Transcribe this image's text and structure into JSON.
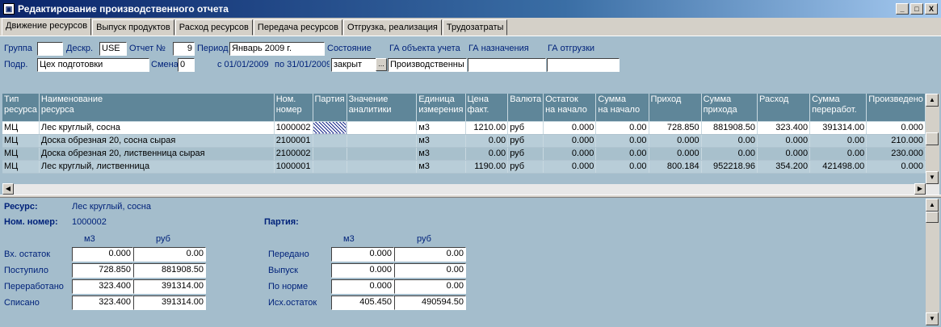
{
  "window": {
    "title": "Редактирование производственного отчета",
    "icon": "app-icon",
    "min": "_",
    "max": "□",
    "close": "X"
  },
  "tabs": [
    "Движение ресурсов",
    "Выпуск продуктов",
    "Расход ресурсов",
    "Передача ресурсов",
    "Отгрузка, реализация",
    "Трудозатраты"
  ],
  "filters": {
    "group_label": "Группа",
    "group_value": "",
    "descr_label": "Дескр.",
    "descr_value": "USE",
    "report_label": "Отчет №",
    "report_value": "9",
    "period_label": "Период",
    "period_value": "Январь 2009 г.",
    "state_label": "Состояние",
    "ga_object_label": "ГА объекта учета",
    "ga_dest_label": "ГА назначения",
    "ga_ship_label": "ГА отгрузки",
    "dept_label": "Подр.",
    "dept_value": "Цех подготовки",
    "shift_label": "Смена",
    "shift_value": "0",
    "date_from": "с 01/01/2009",
    "date_to": "по 31/01/2009",
    "state_value": "закрыт",
    "state_btn": "...",
    "ga_object_value": "Производственны",
    "ga_dest_value": "",
    "ga_ship_value": ""
  },
  "grid": {
    "headers": [
      "Тип\nресурса",
      "Наименование\nресурса",
      "Ном.\nномер",
      "Партия",
      "Значение\nаналитики",
      "Единица\nизмерения",
      "Цена\nфакт.",
      "Валюта",
      "Остаток\nна начало",
      "Сумма\nна начало",
      "Приход",
      "Сумма\nприхода",
      "Расход",
      "Сумма\nпереработ.",
      "Произведено"
    ],
    "rows": [
      [
        "МЦ",
        "Лес круглый, сосна",
        "1000002",
        "",
        "",
        "м3",
        "1210.00",
        "руб",
        "0.000",
        "0.00",
        "728.850",
        "881908.50",
        "323.400",
        "391314.00",
        "0.000"
      ],
      [
        "МЦ",
        "Доска обрезная 20, сосна сырая",
        "2100001",
        "",
        "",
        "м3",
        "0.00",
        "руб",
        "0.000",
        "0.00",
        "0.000",
        "0.00",
        "0.000",
        "0.00",
        "210.000"
      ],
      [
        "МЦ",
        "Доска обрезная 20, лиственница сырая",
        "2100002",
        "",
        "",
        "м3",
        "0.00",
        "руб",
        "0.000",
        "0.00",
        "0.000",
        "0.00",
        "0.000",
        "0.00",
        "230.000"
      ],
      [
        "МЦ",
        "Лес круглый, лиственница",
        "1000001",
        "",
        "",
        "м3",
        "1190.00",
        "руб",
        "0.000",
        "0.00",
        "800.184",
        "952218.96",
        "354.200",
        "421498.00",
        "0.000"
      ]
    ]
  },
  "details": {
    "resource_label": "Ресурс:",
    "resource_value": "Лес круглый, сосна",
    "nom_label": "Ном. номер:",
    "nom_value": "1000002",
    "batch_label": "Партия:",
    "unit1": "м3",
    "cur1": "руб",
    "unit2": "м3",
    "cur2": "руб",
    "left": [
      {
        "label": "Вх. остаток",
        "q": "0.000",
        "s": "0.00"
      },
      {
        "label": "Поступило",
        "q": "728.850",
        "s": "881908.50"
      },
      {
        "label": "Переработано",
        "q": "323.400",
        "s": "391314.00"
      },
      {
        "label": "Списано",
        "q": "323.400",
        "s": "391314.00"
      }
    ],
    "right": [
      {
        "label": "Передано",
        "q": "0.000",
        "s": "0.00"
      },
      {
        "label": "Выпуск",
        "q": "0.000",
        "s": "0.00"
      },
      {
        "label": "По норме",
        "q": "0.000",
        "s": "0.00"
      },
      {
        "label": "Исх.остаток",
        "q": "405.450",
        "s": "490594.50"
      }
    ]
  }
}
